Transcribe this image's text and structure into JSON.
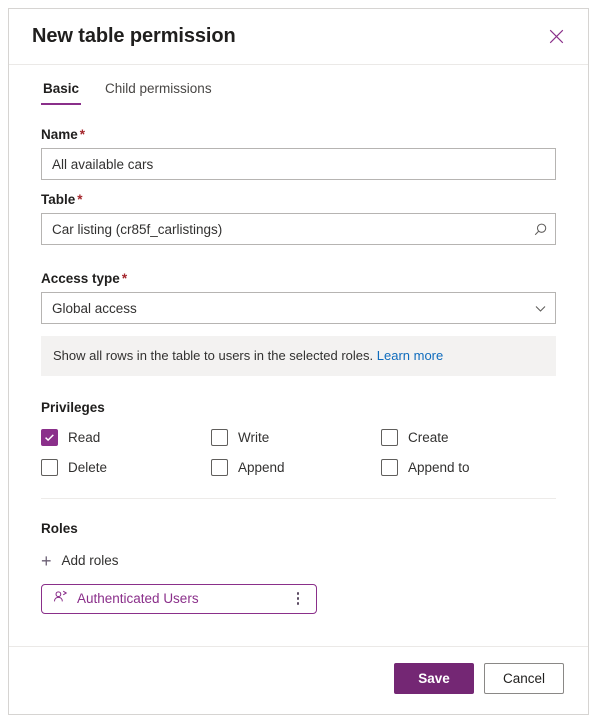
{
  "dialog": {
    "title": "New table permission",
    "close_icon": "close-icon"
  },
  "tabs": [
    {
      "label": "Basic",
      "active": true
    },
    {
      "label": "Child permissions",
      "active": false
    }
  ],
  "form": {
    "name": {
      "label": "Name",
      "required_marker": "*",
      "value": "All available cars"
    },
    "table": {
      "label": "Table",
      "required_marker": "*",
      "value": "Car listing (cr85f_carlistings)",
      "icon": "search-icon"
    },
    "access_type": {
      "label": "Access type",
      "required_marker": "*",
      "value": "Global access",
      "icon": "chevron-down-icon",
      "options": [
        "Global access"
      ]
    },
    "info": {
      "text": "Show all rows in the table to users in the selected roles.",
      "link_label": "Learn more"
    }
  },
  "privileges": {
    "title": "Privileges",
    "items": [
      {
        "label": "Read",
        "checked": true
      },
      {
        "label": "Write",
        "checked": false
      },
      {
        "label": "Create",
        "checked": false
      },
      {
        "label": "Delete",
        "checked": false
      },
      {
        "label": "Append",
        "checked": false
      },
      {
        "label": "Append to",
        "checked": false
      }
    ]
  },
  "roles": {
    "title": "Roles",
    "add_label": "Add roles",
    "add_icon": "plus-icon",
    "chips": [
      {
        "label": "Authenticated Users",
        "icon": "person-icon",
        "more_icon": "more-vertical-icon"
      }
    ]
  },
  "footer": {
    "save_label": "Save",
    "cancel_label": "Cancel"
  },
  "colors": {
    "accent_purple": "#8a2f8a",
    "save_button": "#742774",
    "link_blue": "#0f6cbd",
    "required_red": "#a4262c",
    "info_background": "#f3f2f1"
  }
}
